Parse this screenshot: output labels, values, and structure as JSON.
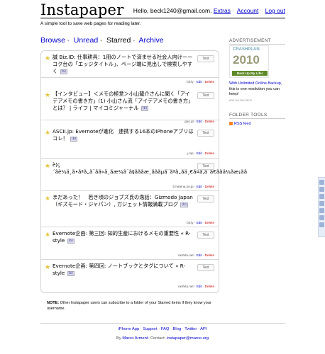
{
  "header": {
    "logo": "Instapaper",
    "greeting": "Hello, beck1240@gmail.com.",
    "links": {
      "extras": "Extras",
      "account": "Account",
      "logout": "Log out"
    },
    "tagline": "A simple tool to save web pages for reading later."
  },
  "nav": {
    "browse": "Browse",
    "unread": "Unread",
    "starred": "Starred",
    "archive": "Archive"
  },
  "items": [
    {
      "title": "誠 Biz.ID: 仕事耕具：1冊のノートで済ませる社会人向けーーコク台の「エッジタイトル」、ページ端に見出しで検索しやすく",
      "tag": "(b)",
      "source": "bit.ly",
      "text_btn": "Text",
      "edit": "Edit",
      "delete": "Delete"
    },
    {
      "title": "【インタビュー】＜メモの極意＞小山龍介さんに聞く「アイデアメモの書き方」(1) 小山さん流「アイデアメモの書き方」とは？ | ライフ | マイコミジャーナル",
      "tag": "(b)",
      "source": "goo.gl",
      "text_btn": "Text",
      "edit": "Edit",
      "delete": "Delete"
    },
    {
      "title": "ASCII.jp: Evernoteが進化　連携する16本のiPhoneアプリはコレ！",
      "tag": "(b)",
      "source": "j.mp",
      "text_btn": "Text",
      "edit": "Edit",
      "delete": "Delete"
    },
    {
      "title": "è¦ç´ãè¼ä¸ã•ãªã„ã¨ãã«ä¸ãæ¼ã¨ã§ãããæ¸ãããµã¨ãªã„ãä¸€ã¤ã‚ã¨ã€ããä¼ãæ¡ãã",
      "tag": "",
      "source": "b.hatena.ne.jp",
      "text_btn": "Text",
      "edit": "Edit",
      "delete": "Delete"
    },
    {
      "title": "まだあった！　若き頃のジョブズ氏の逸話：Gizmodo Japan（ギズモード・ジャパン）, ガジェット情報満載ブログ",
      "tag": "(b)",
      "source": "bit.ly",
      "text_btn": "Text",
      "edit": "Edit",
      "delete": "Delete"
    },
    {
      "title": "Evernote企画: 第三回: 知的生産におけるメモの重要性 « R-style",
      "tag": "(b)",
      "source": "rashita.net",
      "text_btn": "Text",
      "edit": "Edit",
      "delete": "Delete"
    },
    {
      "title": "Evernote企画: 第四回: ノートブックとタグについて « R-style",
      "tag": "(b)",
      "source": "rashita.net",
      "text_btn": "Text",
      "edit": "Edit",
      "delete": "Delete"
    }
  ],
  "note": {
    "label": "NOTE:",
    "text": " Other Instapaper users can subscribe to a folder of your Starred items if they know your username."
  },
  "sidebar": {
    "ad_heading": "ADVERTISEMENT",
    "ad_image": {
      "brand": "CRASHPLAN",
      "year": "2010",
      "slogan": "Back Up My Life!"
    },
    "ad_link": "With Unlimited Online Backup,",
    "ad_text": " this is one resolution you can keep!",
    "ad_small": "ADS VIA THE DECK",
    "folder_heading": "FOLDER TOOLS",
    "rss": "RSS feed"
  },
  "footer": {
    "links": [
      "iPhone App",
      "Support",
      "FAQ",
      "Blog",
      "Twitter",
      "API"
    ],
    "credit_by": "By ",
    "author": "Marco Arment",
    "contact_label": ". Contact: ",
    "contact": "instapaper@marco.org"
  },
  "colors": {
    "link": "#0000cc",
    "star": "#e6c53a",
    "delete": "#cc0000"
  }
}
